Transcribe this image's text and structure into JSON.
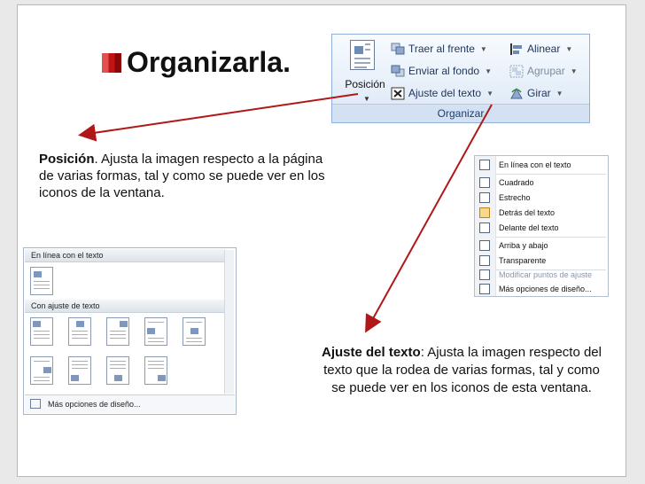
{
  "title": "Organizarla.",
  "ribbon": {
    "posicion_label": "Posición",
    "traer_label": "Traer al frente",
    "enviar_label": "Enviar al fondo",
    "ajuste_label": "Ajuste del texto",
    "alinear_label": "Alinear",
    "agrupar_label": "Agrupar",
    "girar_label": "Girar",
    "group_label": "Organizar"
  },
  "posicion_text": {
    "bold": "Posición",
    "rest": ". Ajusta la imagen respecto a la página de varias formas, tal y como se puede ver en los iconos de la ventana."
  },
  "ajuste_text": {
    "bold": "Ajuste del texto",
    "rest": ": Ajusta la imagen respecto del texto que la rodea de varias formas, tal y como se puede ver en los iconos de esta ventana."
  },
  "position_menu": {
    "section1": "En línea con el texto",
    "section2": "Con ajuste de texto",
    "more": "Más opciones de diseño..."
  },
  "wrap_menu": {
    "items": [
      "En línea con el texto",
      "Cuadrado",
      "Estrecho",
      "Detrás del texto",
      "Delante del texto",
      "Arriba y abajo",
      "Transparente",
      "Modificar puntos de ajuste",
      "Más opciones de diseño..."
    ]
  },
  "colors": {
    "accent_red": "#c00000",
    "arrow": "#b01818",
    "ribbon_blue": "#1d3e6e"
  }
}
